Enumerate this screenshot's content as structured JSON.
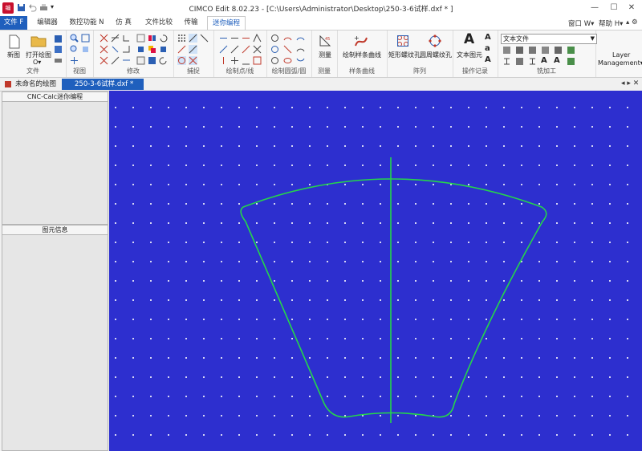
{
  "window": {
    "title": "CIMCO Edit 8.02.23 - [C:\\Users\\Administrator\\Desktop\\250-3-6试样.dxf * ]",
    "logo_text": "编"
  },
  "menu": {
    "tabs": [
      "文件 F",
      "编辑器",
      "数控功能 N",
      "仿 真",
      "文件比较",
      "传输",
      "迷你编程"
    ],
    "right": [
      "窗口 W▾",
      "帮助 H▾"
    ]
  },
  "ribbon": {
    "groups": [
      "文件",
      "视图",
      "修改",
      "捕捉",
      "绘制点/线",
      "绘制圆弧/圆",
      "测量",
      "样条曲线",
      "阵列",
      "操作记录",
      "铣加工"
    ],
    "buttons": {
      "new": "新图",
      "open": "打开绘图",
      "measure": "测量",
      "spline": "绘制样条曲线",
      "rect_array": "矩形螺纹孔",
      "circ_array": "圆周螺纹孔",
      "text": "文本图元",
      "open_extra": "O▾",
      "layer": "Layer",
      "layer2": "Management▾"
    },
    "combo_value": "文本文件"
  },
  "doc_tabs": [
    "未命名的绘图",
    "250-3-6试样.dxf *"
  ],
  "panels": {
    "top_title": "CNC-Calc迷你编程",
    "bottom_title": "图元信息"
  },
  "colors": {
    "canvas": "#2d2fcf",
    "contour": "#25d64a",
    "accent": "#1f5fbd"
  }
}
